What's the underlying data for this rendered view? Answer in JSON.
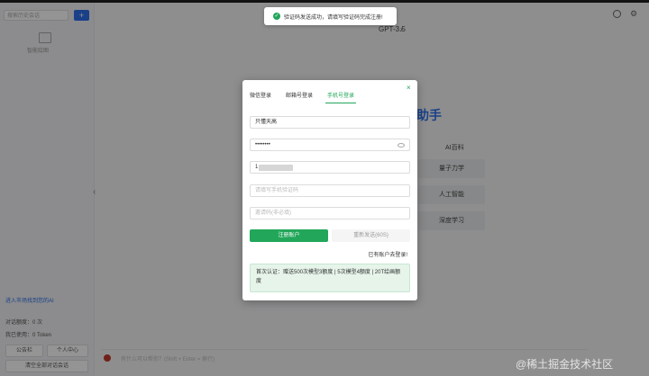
{
  "sidebar": {
    "search_placeholder": "搜索历史会话",
    "add_label": "+",
    "image_label": "智能绘图",
    "market_link": "进入市场找到您的AI",
    "stat_balance": "对话额度：0 次",
    "stat_used": "我已使用：0 Token",
    "btn_public": "公告栏",
    "btn_personal": "个人中心",
    "btn_clear": "清空全部对话会话"
  },
  "header": {
    "model_name": "GPT-3.5",
    "model_chevron": "›",
    "settings_glyph": "⚙"
  },
  "main": {
    "assistant_title": "助手",
    "ai_label": "AI百科",
    "cards": [
      "量子力学",
      "人工智能",
      "深度学习"
    ],
    "input_placeholder": "有什么可以帮你？(Shift + Enter = 换行)",
    "left_arrow": "‹"
  },
  "toast": {
    "icon": "✓",
    "message": "验证码发送成功，请填写验证码完成注册!"
  },
  "modal": {
    "close_glyph": "×",
    "tabs": [
      "微信登录",
      "邮箱号登录",
      "手机号登录"
    ],
    "active_tab": 2,
    "nickname_value": "只懂天高",
    "password_value": "••••••••",
    "phone_value": "1",
    "code_placeholder": "请填写手机验证码",
    "invite_placeholder": "邀请码(非必填)",
    "register_label": "注册账户",
    "resend_label": "重新发送(60S)",
    "login_link": "已有账户去登录!",
    "notice": "首次认证：赠送500次模型3额度 | 5次模型4额度 | 20T绘画额度"
  },
  "watermark": "@稀土掘金技术社区",
  "colors": {
    "accent_green": "#22a65a",
    "accent_blue": "#2e6fe8"
  }
}
